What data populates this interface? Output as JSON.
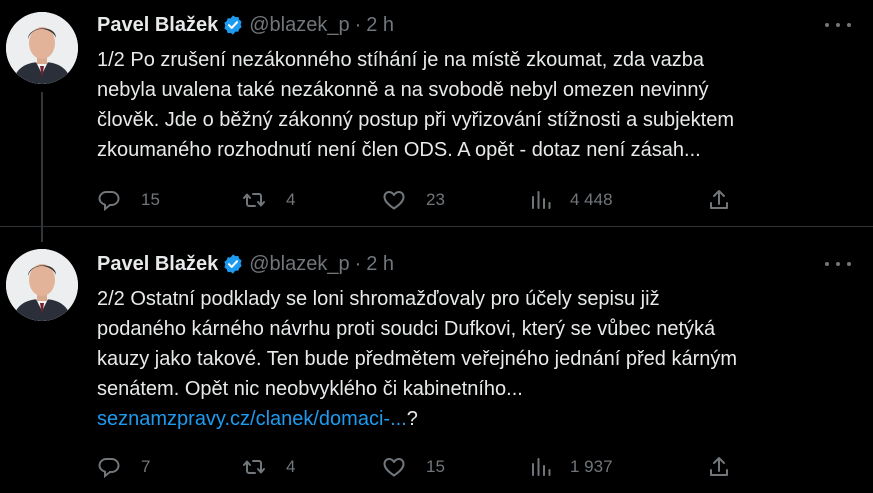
{
  "colors": {
    "background": "#000000",
    "text": "#e7e9ea",
    "muted": "#71767b",
    "link": "#1d9bf0",
    "verified": "#1d9bf0",
    "divider": "#2f3336"
  },
  "tweets": [
    {
      "author": "Pavel Blažek",
      "handle": "@blazek_p",
      "separator": "·",
      "time": "2 h",
      "text": "1/2 Po zrušení nezákonného stíhání je na místě zkoumat, zda vazba\nnebyla uvalena také nezákonně a na svobodě nebyl omezen nevinný\nčlověk. Jde o běžný zákonný postup při vyřizování stížnosti a subjektem\nzkoumaného rozhodnutí není člen ODS. A opět - dotaz není zásah...",
      "link": "",
      "link_suffix": "",
      "replies": "15",
      "retweets": "4",
      "likes": "23",
      "views": "4 448",
      "icons": [
        "reply-icon",
        "retweet-icon",
        "like-icon",
        "views-icon",
        "share-icon",
        "more-icon",
        "verified-badge-icon"
      ]
    },
    {
      "author": "Pavel Blažek",
      "handle": "@blazek_p",
      "separator": "·",
      "time": "2 h",
      "text": "2/2 Ostatní podklady se loni shromažďovaly pro účely sepisu již\npodaného kárného návrhu proti soudci Dufkovi, který se vůbec netýká\nkauzy jako takové. Ten bude předmětem veřejného jednání před kárným\nsenátem. Opět nic neobvyklého či kabinetního...\n",
      "link": "seznamzpravy.cz/clanek/domaci-...",
      "link_suffix": "?",
      "replies": "7",
      "retweets": "4",
      "likes": "15",
      "views": "1 937",
      "icons": [
        "reply-icon",
        "retweet-icon",
        "like-icon",
        "views-icon",
        "share-icon",
        "more-icon",
        "verified-badge-icon"
      ]
    }
  ]
}
